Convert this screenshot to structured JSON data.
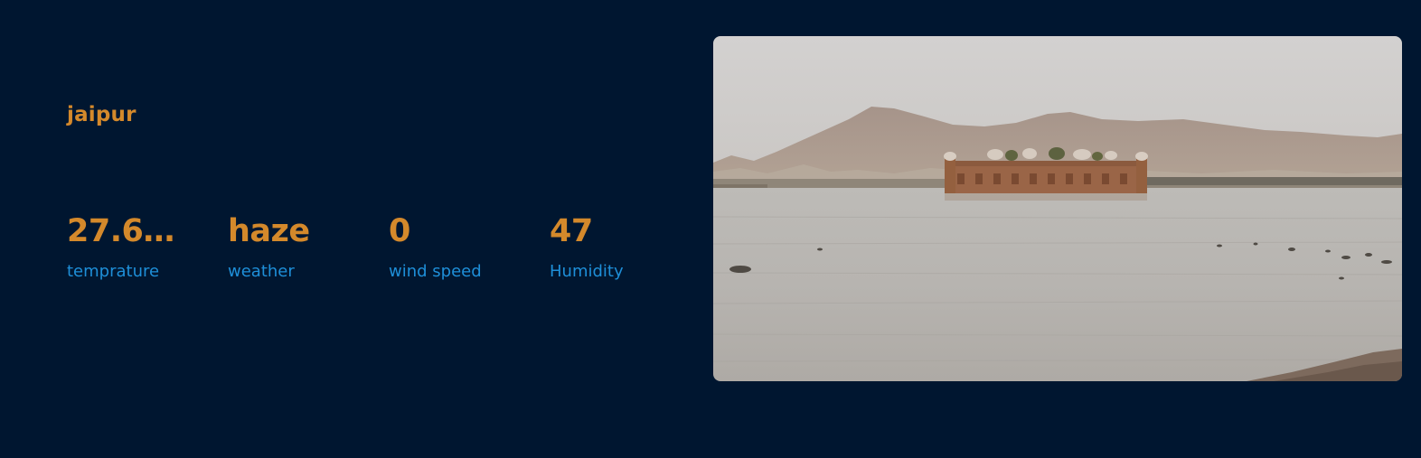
{
  "location": {
    "city": "jaipur"
  },
  "stats": [
    {
      "value": "27.6...",
      "label": "temprature"
    },
    {
      "value": "haze",
      "label": "weather"
    },
    {
      "value": "0",
      "label": "wind speed"
    },
    {
      "value": "47",
      "label": "Humidity"
    }
  ],
  "colors": {
    "background": "#001630",
    "accent": "#d4892b",
    "label": "#1e8fd8"
  }
}
